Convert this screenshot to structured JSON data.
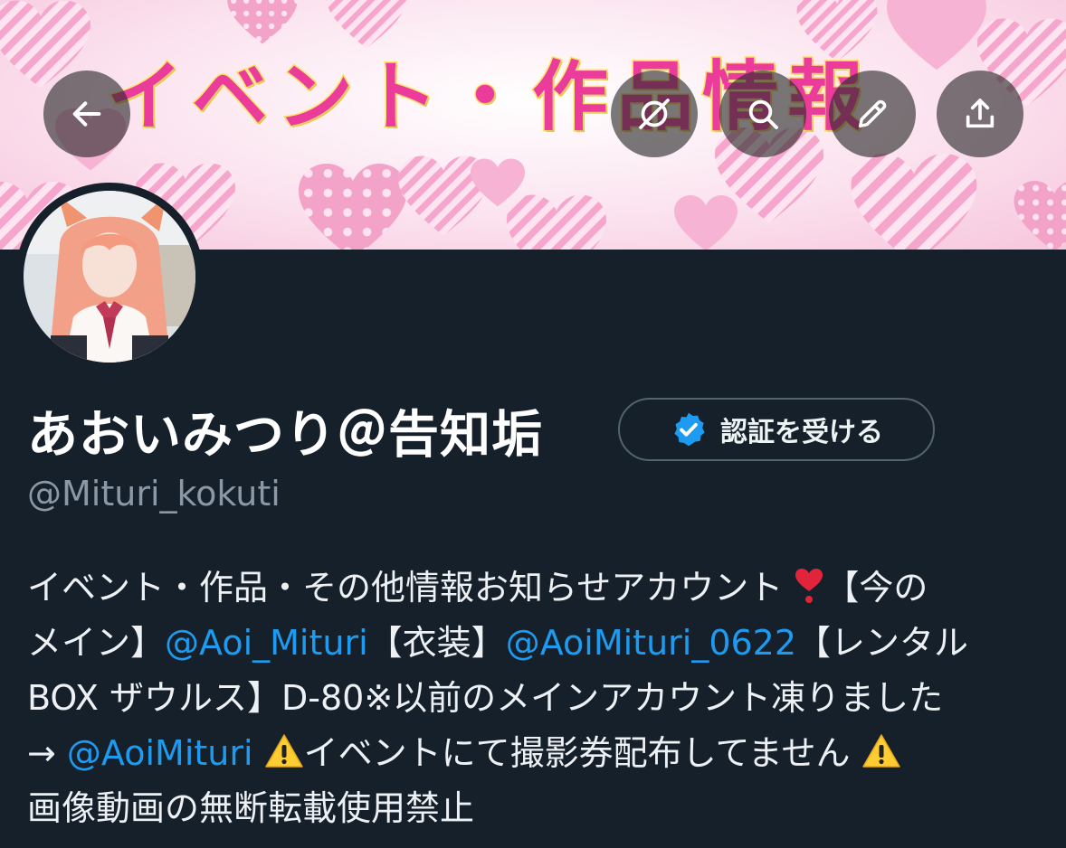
{
  "banner": {
    "title": "イベント・作品情報",
    "colors": {
      "title_fill": "#ec3c9b",
      "title_outline": "#ffd54a",
      "hearts": "#f7a8cf"
    }
  },
  "toolbar": {
    "back_icon": "arrow-left-icon",
    "icons": [
      "hide-icon",
      "search-icon",
      "edit-icon",
      "share-icon"
    ]
  },
  "profile": {
    "display_name": "あおいみつり＠告知垢",
    "handle": "@Mituri_kokuti",
    "verify_button_label": "認証を受ける",
    "bio": {
      "line1_text": "イベント・作品・その他情報お知らせアカウント",
      "line1_tail": "【今の",
      "line2_pre": "メイン】",
      "line2_mention1": "@Aoi_Mituri",
      "line2_mid": "【衣装】",
      "line2_mention2": "@AoiMituri_0622",
      "line2_tail": "【レンタル",
      "line3": "BOX ザウルス】D-80※以前のメインアカウント凍りました",
      "line4_pre": "→ ",
      "line4_mention": "@AoiMituri",
      "line4_text": "イベントにて撮影券配布してません",
      "line5": "画像動画の無断転載使用禁止"
    }
  },
  "colors": {
    "background": "#15202b",
    "link": "#1d9bf0",
    "secondary_text": "#8b98a5",
    "verified_badge": "#1d9bf0"
  }
}
